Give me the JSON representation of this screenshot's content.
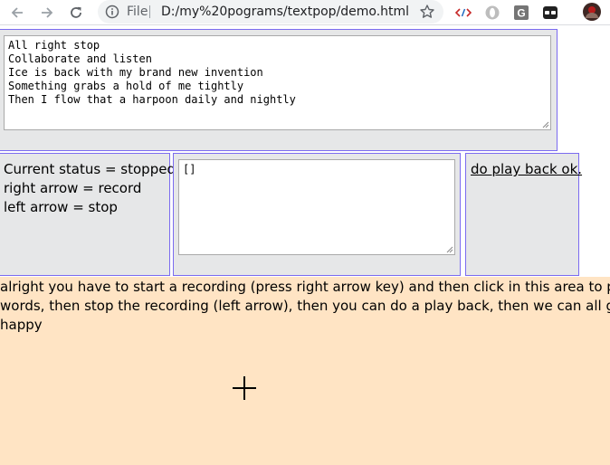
{
  "browser": {
    "url_scheme": "File",
    "url": "D:/my%20pograms/textpop/demo.html",
    "icons": [
      "back-arrow-icon",
      "forward-arrow-icon",
      "reload-icon",
      "info-icon",
      "star-icon",
      "code-extension-icon",
      "opera-extension-icon",
      "g-extension-icon",
      "bot-extension-icon",
      "profile-avatar"
    ]
  },
  "page": {
    "lyrics": {
      "lines": [
        "All right stop",
        "Collaborate and listen",
        "Ice is back with my brand new invention",
        "Something grabs a hold of me tightly",
        "Then I flow that a harpoon daily and nightly"
      ]
    },
    "status": {
      "current": "Current status = stopped",
      "right": "right arrow = record",
      "left": "left arrow = stop"
    },
    "events_value": "[]",
    "play_link": "do play back ok.",
    "instructions": [
      "alright you have to start a recording (press right arrow key) and then click in this area to place the",
      "words, then stop the recording (left arrow), then you can do a play back, then we can all go home",
      "happy"
    ]
  },
  "colors": {
    "panel_bg": "#e6e7e8",
    "panel_border": "#7b6bf0",
    "stage_bg": "#ffe4c4"
  }
}
